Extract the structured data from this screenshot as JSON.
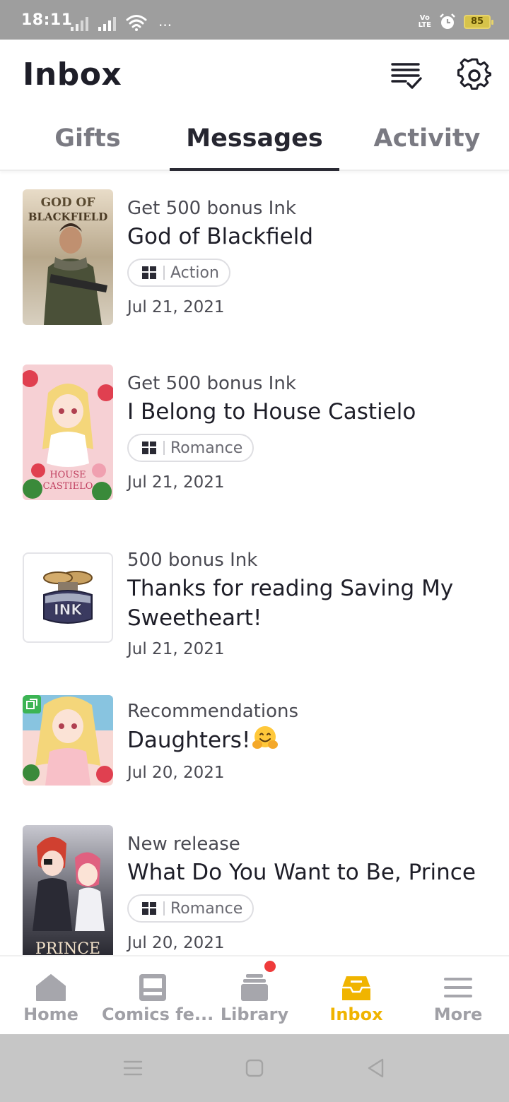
{
  "status_bar": {
    "time": "18:11",
    "volte_line1": "Vo",
    "volte_line2": "LTE",
    "battery": "85",
    "dots": "···"
  },
  "header": {
    "title": "Inbox",
    "icons": [
      "mark-all-read-icon",
      "settings-gear-icon"
    ]
  },
  "tabs": [
    {
      "label": "Gifts",
      "active": false
    },
    {
      "label": "Messages",
      "active": true
    },
    {
      "label": "Activity",
      "active": false
    }
  ],
  "messages": [
    {
      "type": "Get 500 bonus Ink",
      "title": "God of Blackfield",
      "tag": "Action",
      "date": "Jul 21, 2021",
      "cover_text": "GOD OF BLACKFIELD"
    },
    {
      "type": "Get 500 bonus Ink",
      "title": "I Belong to House Castielo",
      "tag": "Romance",
      "date": "Jul 21, 2021",
      "cover_text": "HOUSE CASTIELO"
    },
    {
      "type": "500 bonus Ink",
      "title": "Thanks for reading Saving My Sweetheart!",
      "tag": "",
      "date": "Jul 21, 2021",
      "cover_text": "INK"
    },
    {
      "type": "Recommendations",
      "title": "Daughters!",
      "tag": "",
      "date": "Jul 20, 2021",
      "cover_text": ""
    },
    {
      "type": "New release",
      "title": "What Do You Want to Be, Prince",
      "tag": "Romance",
      "date": "Jul 20, 2021",
      "cover_text": "PRINCE"
    }
  ],
  "bottom_nav": [
    {
      "label": "Home",
      "icon": "home-icon"
    },
    {
      "label": "Comics fe...",
      "icon": "comics-feed-icon"
    },
    {
      "label": "Library",
      "icon": "library-icon",
      "badge": true
    },
    {
      "label": "Inbox",
      "icon": "inbox-icon",
      "active": true
    },
    {
      "label": "More",
      "icon": "menu-icon"
    }
  ],
  "colors": {
    "accent": "#f0b400",
    "text_primary": "#1e1e28",
    "inactive": "#a0a0a6",
    "badge": "#ef3b3b"
  }
}
